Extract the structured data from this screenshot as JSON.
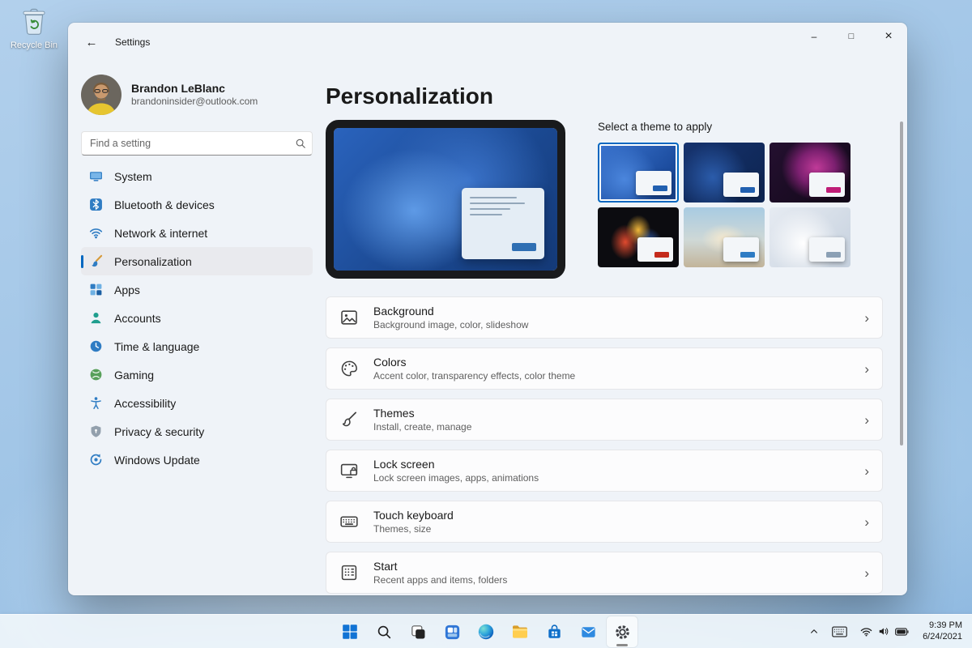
{
  "colors": {
    "accent": "#0067c0"
  },
  "icons": {
    "back": "←",
    "minimize": "–",
    "maximize": "□",
    "close": "×",
    "chevron": "›"
  },
  "desktop": {
    "recycle_bin_label": "Recycle Bin"
  },
  "window": {
    "title": "Settings"
  },
  "user": {
    "name": "Brandon LeBlanc",
    "email": "brandoninsider@outlook.com"
  },
  "search": {
    "placeholder": "Find a setting"
  },
  "sidebar": {
    "items": [
      {
        "label": "System"
      },
      {
        "label": "Bluetooth & devices"
      },
      {
        "label": "Network & internet"
      },
      {
        "label": "Personalization",
        "selected": true
      },
      {
        "label": "Apps"
      },
      {
        "label": "Accounts"
      },
      {
        "label": "Time & language"
      },
      {
        "label": "Gaming"
      },
      {
        "label": "Accessibility"
      },
      {
        "label": "Privacy & security"
      },
      {
        "label": "Windows Update"
      }
    ]
  },
  "main": {
    "title": "Personalization",
    "themes_label": "Select a theme to apply",
    "cards": [
      {
        "title": "Background",
        "desc": "Background image, color, slideshow"
      },
      {
        "title": "Colors",
        "desc": "Accent color, transparency effects, color theme"
      },
      {
        "title": "Themes",
        "desc": "Install, create, manage"
      },
      {
        "title": "Lock screen",
        "desc": "Lock screen images, apps, animations"
      },
      {
        "title": "Touch keyboard",
        "desc": "Themes, size"
      },
      {
        "title": "Start",
        "desc": "Recent apps and items, folders"
      }
    ]
  },
  "themes": {
    "items": [
      {
        "name": "windows-blue-bloom",
        "accent": "#2160b0",
        "selected": true
      },
      {
        "name": "windows-dark-blue-bloom",
        "accent": "#2160b0"
      },
      {
        "name": "glow-purple",
        "accent": "#bf1d77"
      },
      {
        "name": "captured-motion",
        "accent": "#c42b1c"
      },
      {
        "name": "sunrise-beach",
        "accent": "#2f7cc4"
      },
      {
        "name": "flow-light",
        "accent": "#8ba0b5"
      }
    ]
  },
  "taskbar": {
    "clock": {
      "time": "9:39 PM",
      "date": "6/24/2021"
    }
  }
}
